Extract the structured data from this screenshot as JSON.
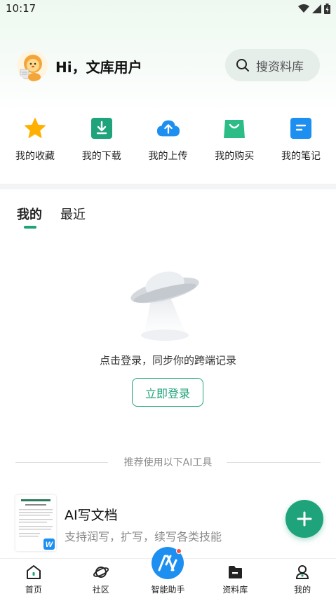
{
  "status_bar": {
    "time": "10:17"
  },
  "header": {
    "greeting": "Hi，文库用户",
    "search_placeholder": "搜资料库"
  },
  "quick_actions": [
    {
      "label": "我的收藏",
      "icon": "star-icon",
      "color": "#ffb000"
    },
    {
      "label": "我的下载",
      "icon": "download-icon",
      "color": "#1fa37a"
    },
    {
      "label": "我的上传",
      "icon": "upload-cloud-icon",
      "color": "#1d8ff0"
    },
    {
      "label": "我的购买",
      "icon": "shopping-bag-icon",
      "color": "#2bbd85"
    },
    {
      "label": "我的笔记",
      "icon": "note-icon",
      "color": "#1d8ff0"
    }
  ],
  "tabs": [
    {
      "label": "我的",
      "active": true
    },
    {
      "label": "最近",
      "active": false
    }
  ],
  "empty_state": {
    "message": "点击登录，同步你的跨端记录",
    "login_button": "立即登录"
  },
  "recommend": {
    "title": "推荐使用以下AI工具",
    "tool": {
      "name": "AI写文档",
      "description": "支持润写，扩写，续写各类技能"
    }
  },
  "bottom_nav": [
    {
      "label": "首页",
      "icon": "home-icon"
    },
    {
      "label": "社区",
      "icon": "planet-icon"
    },
    {
      "label": "智能助手",
      "icon": "ai-assistant-icon"
    },
    {
      "label": "资料库",
      "icon": "library-icon"
    },
    {
      "label": "我的",
      "icon": "profile-icon"
    }
  ],
  "colors": {
    "accent": "#1fa37a",
    "blue": "#1d8ff0"
  }
}
